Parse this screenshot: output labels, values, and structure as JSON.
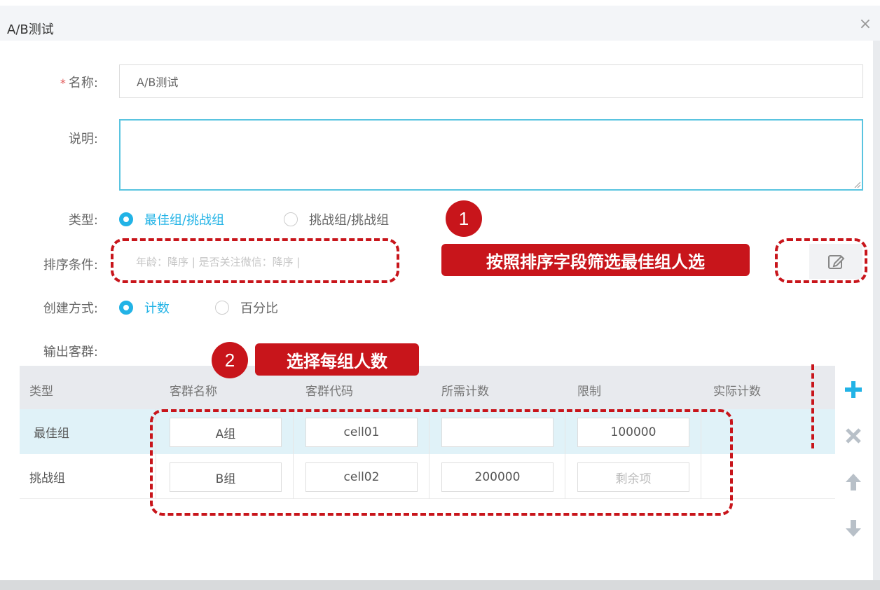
{
  "dialog": {
    "title": "A/B测试",
    "close_symbol": "×"
  },
  "form": {
    "name_label": "名称:",
    "name_value": "A/B测试",
    "desc_label": "说明:",
    "type_label": "类型:",
    "type_options": [
      "最佳组/挑战组",
      "挑战组/挑战组"
    ],
    "sort_label": "排序条件:",
    "sort_value": "年龄：降序 | 是否关注微信：降序 |",
    "create_label": "创建方式:",
    "create_options": [
      "计数",
      "百分比"
    ],
    "output_label": "输出客群:"
  },
  "annotations": {
    "badge1": "1",
    "callout1": "按照排序字段筛选最佳组人选",
    "badge2": "2",
    "callout2": "选择每组人数"
  },
  "table": {
    "headers": [
      "类型",
      "客群名称",
      "客群代码",
      "所需计数",
      "限制",
      "实际计数"
    ],
    "rows": [
      {
        "type": "最佳组",
        "name": "A组",
        "code": "cell01",
        "required": "",
        "limit": "100000",
        "actual": ""
      },
      {
        "type": "挑战组",
        "name": "B组",
        "code": "cell02",
        "required": "200000",
        "limit": "剩余项",
        "actual": ""
      }
    ]
  },
  "colors": {
    "accent": "#22b3e6",
    "annotation_red": "#c8151b",
    "add_icon": "#22b3e6",
    "muted_icon": "#b8c0c8"
  },
  "icons": [
    "close-icon",
    "edit-icon",
    "plus-icon",
    "delete-icon",
    "arrow-up-icon",
    "arrow-down-icon"
  ]
}
